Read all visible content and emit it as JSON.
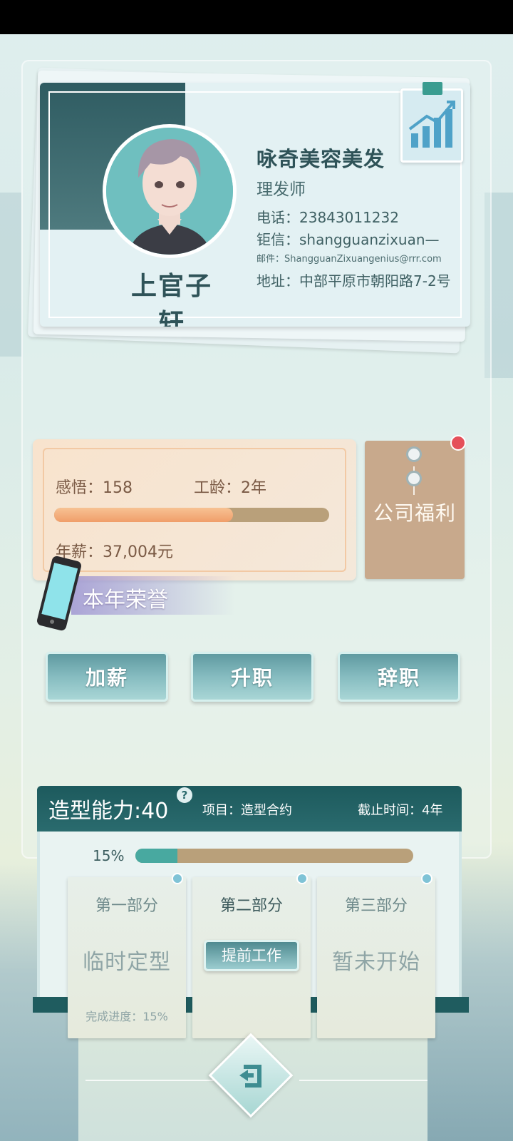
{
  "profile": {
    "name": "上官子轩",
    "company": "咏奇美容美发",
    "job": "理发师",
    "phone": "电话：23843011232",
    "wechat": "钜信：shangguanzixuan—",
    "email": "邮件：ShangguanZixuangenius@rrr.com",
    "address": "地址：中部平原市朝阳路7-2号"
  },
  "stats": {
    "insight": "感悟：158",
    "work_age": "工龄：2年",
    "salary": "年薪：37,004元",
    "progress": 0.65
  },
  "welfare": {
    "label": "公司福利",
    "has_notification": true
  },
  "honor": {
    "label": "本年荣誉"
  },
  "actions": {
    "raise": "加薪",
    "promote": "升职",
    "resign": "辞职"
  },
  "skill": {
    "title": "造型能力:40",
    "help": "?",
    "project": "项目：造型合约",
    "deadline": "截止时间：4年",
    "percent_label": "15%",
    "percent": 0.15,
    "parts": [
      {
        "title": "第一部分",
        "status": "临时定型",
        "progress": "完成进度：15%"
      },
      {
        "title": "第二部分",
        "button": "提前工作"
      },
      {
        "title": "第三部分",
        "status": "暂未开始"
      }
    ]
  },
  "colors": {
    "header_teal": "#1d5a5d",
    "progress_orange": "#f09e6a",
    "progress_teal": "#48a9a0",
    "track_tan": "#b9a07a",
    "notification_red": "#e5505a"
  },
  "icons": [
    "avatar",
    "chart-icon",
    "phone-icon",
    "help-icon",
    "back-icon",
    "pin-icon"
  ]
}
